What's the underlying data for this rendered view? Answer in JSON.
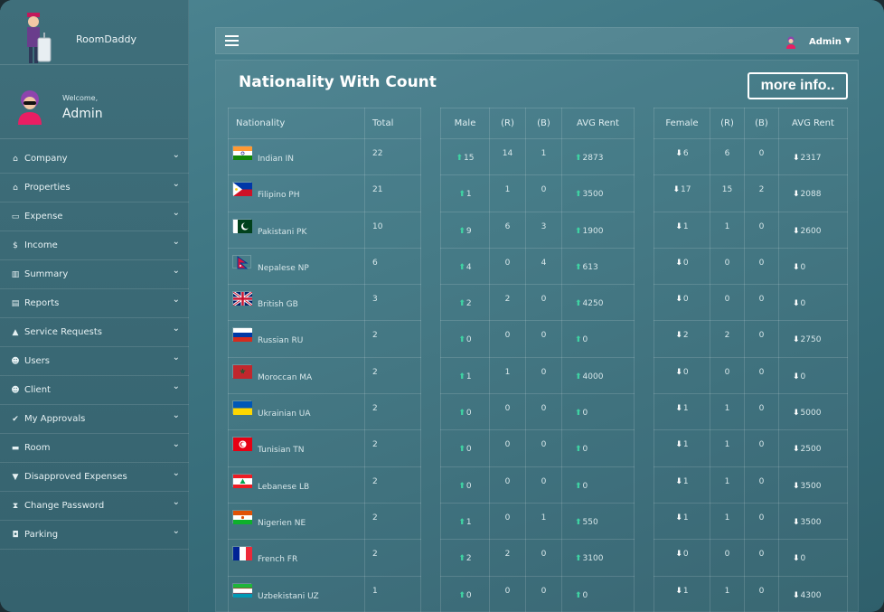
{
  "brand": {
    "name": "RoomDaddy"
  },
  "profile": {
    "welcome": "Welcome,",
    "name": "Admin"
  },
  "menu": [
    {
      "label": "Company",
      "icon": "home-icon"
    },
    {
      "label": "Properties",
      "icon": "home-icon"
    },
    {
      "label": "Expense",
      "icon": "money-bill-icon"
    },
    {
      "label": "Income",
      "icon": "dollar-icon"
    },
    {
      "label": "Summary",
      "icon": "bar-chart-icon"
    },
    {
      "label": "Reports",
      "icon": "file-icon"
    },
    {
      "label": "Service Requests",
      "icon": "warning-icon"
    },
    {
      "label": "Users",
      "icon": "users-icon"
    },
    {
      "label": "Client",
      "icon": "users-icon"
    },
    {
      "label": "My Approvals",
      "icon": "check-icon"
    },
    {
      "label": "Room",
      "icon": "bed-icon"
    },
    {
      "label": "Disapproved Expenses",
      "icon": "thumbs-down-icon"
    },
    {
      "label": "Change Password",
      "icon": "hourglass-icon"
    },
    {
      "label": "Parking",
      "icon": "car-icon"
    }
  ],
  "topbar": {
    "user": "Admin"
  },
  "card": {
    "title": "Nationality With Count",
    "more_button": "more info.."
  },
  "headers": {
    "nationality": "Nationality",
    "total": "Total",
    "male": "Male",
    "r": "(R)",
    "b": "(B)",
    "avg_rent": "AVG Rent",
    "female": "Female"
  },
  "rows": [
    {
      "flag": "IN",
      "nationality": "Indian IN",
      "total": "22",
      "male": "15",
      "male_r": "14",
      "male_b": "1",
      "male_avg": "2873",
      "female": "6",
      "female_r": "6",
      "female_b": "0",
      "female_avg": "2317"
    },
    {
      "flag": "PH",
      "nationality": "Filipino PH",
      "total": "21",
      "male": "1",
      "male_r": "1",
      "male_b": "0",
      "male_avg": "3500",
      "female": "17",
      "female_r": "15",
      "female_b": "2",
      "female_avg": "2088"
    },
    {
      "flag": "PK",
      "nationality": "Pakistani PK",
      "total": "10",
      "male": "9",
      "male_r": "6",
      "male_b": "3",
      "male_avg": "1900",
      "female": "1",
      "female_r": "1",
      "female_b": "0",
      "female_avg": "2600"
    },
    {
      "flag": "NP",
      "nationality": "Nepalese NP",
      "total": "6",
      "male": "4",
      "male_r": "0",
      "male_b": "4",
      "male_avg": "613",
      "female": "0",
      "female_r": "0",
      "female_b": "0",
      "female_avg": "0"
    },
    {
      "flag": "GB",
      "nationality": "British GB",
      "total": "3",
      "male": "2",
      "male_r": "2",
      "male_b": "0",
      "male_avg": "4250",
      "female": "0",
      "female_r": "0",
      "female_b": "0",
      "female_avg": "0"
    },
    {
      "flag": "RU",
      "nationality": "Russian RU",
      "total": "2",
      "male": "0",
      "male_r": "0",
      "male_b": "0",
      "male_avg": "0",
      "female": "2",
      "female_r": "2",
      "female_b": "0",
      "female_avg": "2750"
    },
    {
      "flag": "MA",
      "nationality": "Moroccan MA",
      "total": "2",
      "male": "1",
      "male_r": "1",
      "male_b": "0",
      "male_avg": "4000",
      "female": "0",
      "female_r": "0",
      "female_b": "0",
      "female_avg": "0"
    },
    {
      "flag": "UA",
      "nationality": "Ukrainian UA",
      "total": "2",
      "male": "0",
      "male_r": "0",
      "male_b": "0",
      "male_avg": "0",
      "female": "1",
      "female_r": "1",
      "female_b": "0",
      "female_avg": "5000"
    },
    {
      "flag": "TN",
      "nationality": "Tunisian TN",
      "total": "2",
      "male": "0",
      "male_r": "0",
      "male_b": "0",
      "male_avg": "0",
      "female": "1",
      "female_r": "1",
      "female_b": "0",
      "female_avg": "2500"
    },
    {
      "flag": "LB",
      "nationality": "Lebanese LB",
      "total": "2",
      "male": "0",
      "male_r": "0",
      "male_b": "0",
      "male_avg": "0",
      "female": "1",
      "female_r": "1",
      "female_b": "0",
      "female_avg": "3500"
    },
    {
      "flag": "NE",
      "nationality": "Nigerien NE",
      "total": "2",
      "male": "1",
      "male_r": "0",
      "male_b": "1",
      "male_avg": "550",
      "female": "1",
      "female_r": "1",
      "female_b": "0",
      "female_avg": "3500"
    },
    {
      "flag": "FR",
      "nationality": "French FR",
      "total": "2",
      "male": "2",
      "male_r": "2",
      "male_b": "0",
      "male_avg": "3100",
      "female": "0",
      "female_r": "0",
      "female_b": "0",
      "female_avg": "0"
    },
    {
      "flag": "UZ",
      "nationality": "Uzbekistani UZ",
      "total": "1",
      "male": "0",
      "male_r": "0",
      "male_b": "0",
      "male_avg": "0",
      "female": "1",
      "female_r": "1",
      "female_b": "0",
      "female_avg": "4300"
    }
  ],
  "colors": {
    "male_icon": "#3fd3a3",
    "female_icon": "#ffffff"
  }
}
